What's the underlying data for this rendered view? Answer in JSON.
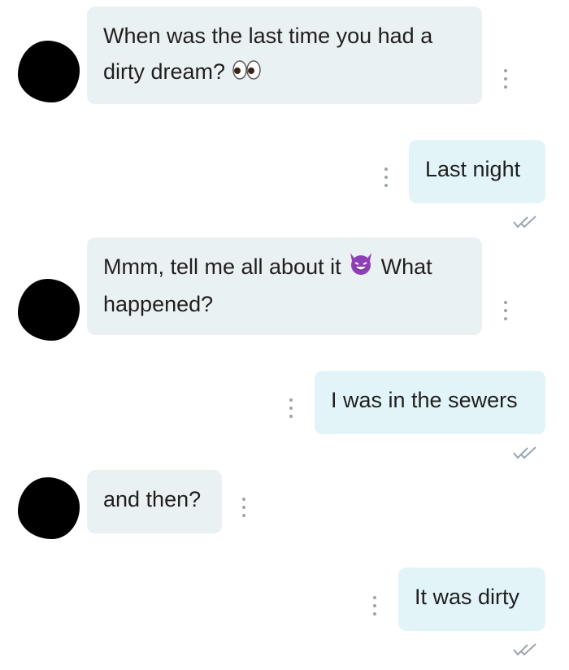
{
  "messages": [
    {
      "id": "m1",
      "side": "incoming",
      "text_before": "When was the last time you had a",
      "text_after": "dirty dream?",
      "emoji": "eyes-emoji"
    },
    {
      "id": "m2",
      "side": "outgoing",
      "text": "Last night"
    },
    {
      "id": "m3",
      "side": "incoming",
      "text_before": "Mmm, tell me all about it",
      "text_after": "What happened?",
      "emoji": "smiling-devil-emoji"
    },
    {
      "id": "m4",
      "side": "outgoing",
      "text": "I was in the sewers"
    },
    {
      "id": "m5",
      "side": "incoming",
      "text": "and then?"
    },
    {
      "id": "m6",
      "side": "outgoing",
      "text": "It was dirty"
    }
  ],
  "colors": {
    "incoming_bubble": "#eaf1f3",
    "outgoing_bubble": "#e2f4f8",
    "text": "#1f1f1f",
    "menu_dots": "#9aa7ad",
    "read_ticks": "#9aa7ad",
    "avatar_redaction": "#000000"
  },
  "icons": {
    "menu": "more-vertical-icon",
    "read_receipt": "double-check-icon"
  }
}
